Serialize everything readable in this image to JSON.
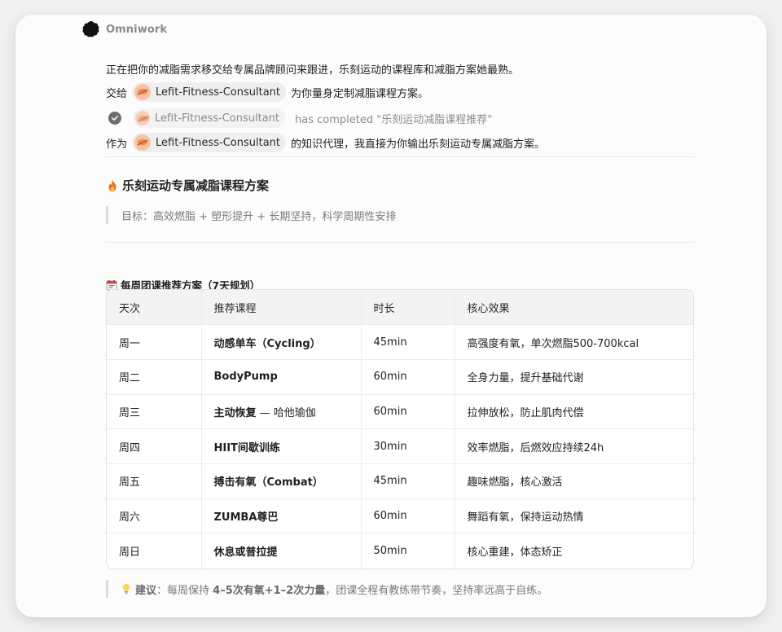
{
  "app": {
    "name": "Omniwork"
  },
  "messages": {
    "intro": "正在把你的减脂需求移交给专属品牌顾问来跟进，乐刻运动的课程库和减脂方案她最熟。",
    "handoff_prefix": "交给",
    "agent_name": "Lefit-Fitness-Consultant",
    "handoff_suffix": "为你量身定制减脂课程方案。",
    "completed_text": "has completed \"乐刻运动减脂课程推荐\"",
    "proxy_prefix": "作为",
    "proxy_suffix": "的知识代理，我直接为你输出乐刻运动专属减脂方案。"
  },
  "plan": {
    "title": "乐刻运动专属减脂课程方案",
    "title_icon": "fire-icon",
    "goal": "目标：高效燃脂 + 塑形提升 + 长期坚持，科学周期性安排",
    "schedule_title": "每周团课推荐方案（7天规划）",
    "schedule_icon": "calendar-icon",
    "table": {
      "headers": [
        "天次",
        "推荐课程",
        "时长",
        "核心效果"
      ],
      "rows": [
        {
          "day": "周一",
          "course": "动感单车（Cycling）",
          "course_extra": "",
          "duration": "45min",
          "effect": "高强度有氧，单次燃脂500-700kcal"
        },
        {
          "day": "周二",
          "course": "BodyPump",
          "course_extra": "",
          "duration": "60min",
          "effect": "全身力量，提升基础代谢"
        },
        {
          "day": "周三",
          "course": "主动恢复",
          "course_extra": " — 哈他瑜伽",
          "duration": "60min",
          "effect": "拉伸放松，防止肌肉代偿"
        },
        {
          "day": "周四",
          "course": "HIIT间歇训练",
          "course_extra": "",
          "duration": "30min",
          "effect": "效率燃脂，后燃效应持续24h"
        },
        {
          "day": "周五",
          "course": "搏击有氧（Combat）",
          "course_extra": "",
          "duration": "45min",
          "effect": "趣味燃脂，核心激活"
        },
        {
          "day": "周六",
          "course": "ZUMBA尊巴",
          "course_extra": "",
          "duration": "60min",
          "effect": "舞蹈有氧，保持运动热情"
        },
        {
          "day": "周日",
          "course": "休息或普拉提",
          "course_extra": "",
          "duration": "50min",
          "effect": "核心重建，体态矫正"
        }
      ]
    },
    "tip": {
      "icon": "lightbulb-icon",
      "label": "建议",
      "text_a": "：每周保持 ",
      "bold": "4–5次有氧+1–2次力量",
      "text_b": "，团课全程有教练带节奏，坚持率远高于自练。"
    }
  }
}
